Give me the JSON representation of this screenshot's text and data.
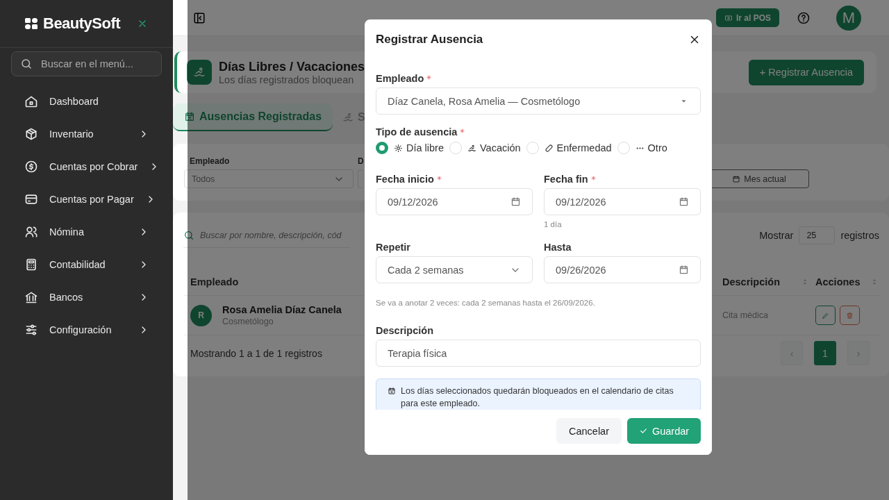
{
  "sidebar": {
    "brand": "BeautySoft",
    "search": {
      "placeholder": "Buscar en el menú..."
    },
    "items": [
      {
        "label": "Dashboard",
        "has_submenu": false
      },
      {
        "label": "Inventario",
        "has_submenu": true
      },
      {
        "label": "Cuentas por Cobrar",
        "has_submenu": true
      },
      {
        "label": "Cuentas por Pagar",
        "has_submenu": true
      },
      {
        "label": "Nómina",
        "has_submenu": true
      },
      {
        "label": "Contabilidad",
        "has_submenu": true
      },
      {
        "label": "Bancos",
        "has_submenu": true
      },
      {
        "label": "Configuración",
        "has_submenu": true
      }
    ]
  },
  "topbar": {
    "pos_button": "Ir al POS",
    "avatar": "M"
  },
  "page": {
    "title": "Días Libres / Vacaciones",
    "subtitle": "Los días registrados bloquean",
    "add_button": "+ Registrar Ausencia",
    "tabs": [
      {
        "label": "Ausencias Registradas",
        "selected": true
      },
      {
        "label": "S",
        "selected": false
      }
    ],
    "filters": [
      {
        "label": "Empleado",
        "value": "Todos"
      },
      {
        "label": "D"
      }
    ],
    "month_button": "Mes actual",
    "search": {
      "placeholder": "Buscar por nombre, descripción, cód"
    },
    "page_size": {
      "prefix": "Mostrar",
      "value": "25",
      "suffix": "registros"
    },
    "table": {
      "columns": [
        {
          "label": "Empleado",
          "sortable": false
        },
        {
          "label": "Descripción",
          "sortable": true
        },
        {
          "label": "Acciones",
          "sortable": true
        }
      ],
      "rows": [
        {
          "avatar": "R",
          "name": "Rosa Amelia Díaz Canela",
          "role": "Cosmetólogo",
          "description": "Cita médica"
        }
      ]
    },
    "footer": "Mostrando 1 a 1 de 1 registros",
    "pagination": {
      "prev": "‹",
      "pages": [
        {
          "label": "1",
          "selected": true
        }
      ],
      "next": "›"
    }
  },
  "modal": {
    "title": "Registrar Ausencia",
    "employee": {
      "label": "Empleado",
      "required": true,
      "value": "Díaz Canela, Rosa Amelia — Cosmetólogo"
    },
    "absence_type": {
      "label": "Tipo de ausencia",
      "required": true,
      "options": [
        {
          "label": "Día libre",
          "selected": true
        },
        {
          "label": "Vacación",
          "selected": false
        },
        {
          "label": "Enfermedad",
          "selected": false
        },
        {
          "label": "Otro",
          "selected": false
        }
      ]
    },
    "start_date": {
      "label": "Fecha inicio",
      "required": true,
      "value": "09/12/2026"
    },
    "end_date": {
      "label": "Fecha fin",
      "required": true,
      "value": "09/12/2026",
      "hint": "1 día"
    },
    "repeat": {
      "label": "Repetir",
      "required": false,
      "value": "Cada 2 semanas"
    },
    "until": {
      "label": "Hasta",
      "required": false,
      "value": "09/26/2026"
    },
    "repeat_note": "Se va a anotar 2 veces: cada 2 semanas hasta el 26/09/2026.",
    "description": {
      "label": "Descripción",
      "required": false,
      "value": "Terapia física"
    },
    "info": "Los días seleccionados quedarán bloqueados en el calendario de citas para este empleado.",
    "cancel_button": "Cancelar",
    "save_button": "Guardar"
  }
}
